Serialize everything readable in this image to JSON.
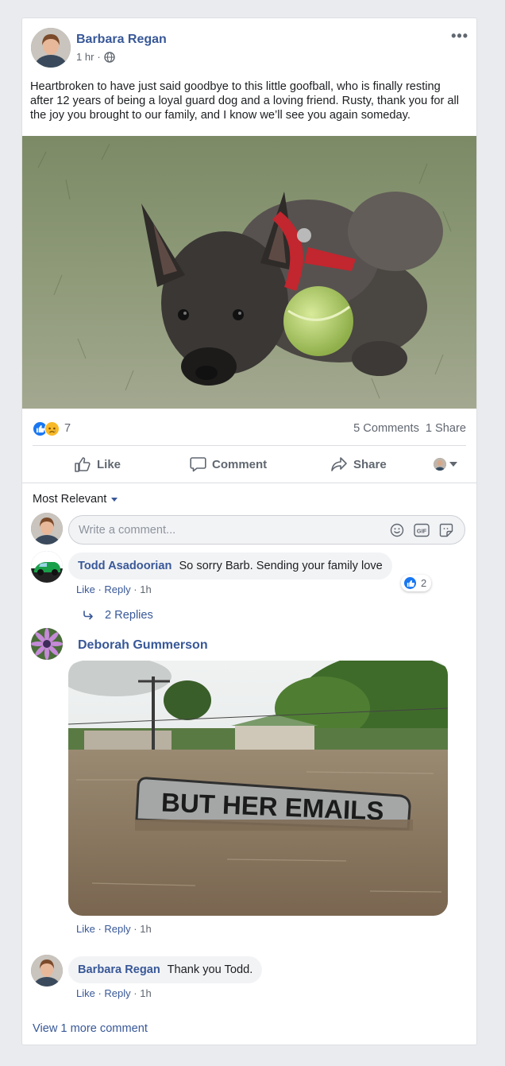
{
  "post": {
    "author": "Barbara Regan",
    "time": "1 hr",
    "separator": "·",
    "more_label": "•••",
    "text": "Heartbroken to have just said goodbye to this little goofball, who is finally resting after 12 years of being a loyal guard dog and a loving friend. Rusty, thank you for all the joy you brought to our family, and I know we’ll see you again someday."
  },
  "stats": {
    "reactions_count": "7",
    "comments": "5 Comments",
    "shares": "1 Share"
  },
  "actions": {
    "like": "Like",
    "comment": "Comment",
    "share": "Share"
  },
  "sort": {
    "label": "Most Relevant"
  },
  "composer": {
    "placeholder": "Write a comment..."
  },
  "comments": [
    {
      "author": "Todd Asadoorian",
      "text": "So sorry Barb. Sending your family love",
      "like": "Like",
      "reply": "Reply",
      "time": "· 1h",
      "reaction_count": "2",
      "replies": "2 Replies"
    },
    {
      "author": "Deborah Gummerson",
      "image_text": "BUT HER EMAILS",
      "like": "Like",
      "reply": "Reply",
      "time": "· 1h"
    },
    {
      "author": "Barbara Regan",
      "text": "Thank you Todd.",
      "like": "Like",
      "reply": "Reply",
      "time": "· 1h"
    }
  ],
  "view_more": "View 1 more comment",
  "colors": {
    "link": "#385898",
    "like_blue": "#1877f2",
    "sad_yellow": "#f7b928",
    "background": "#e9ebee"
  }
}
